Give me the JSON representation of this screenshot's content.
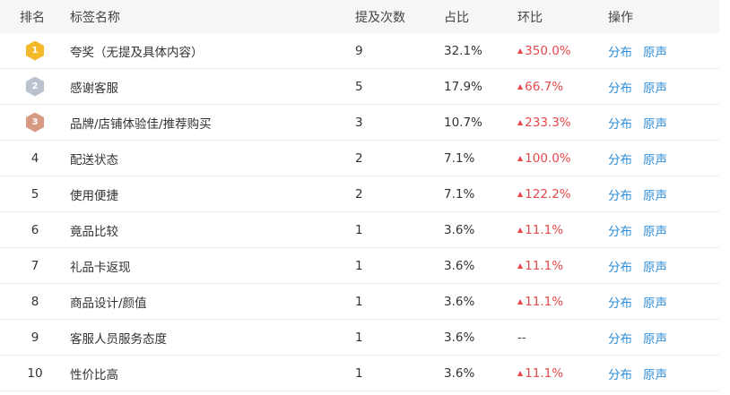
{
  "header": {
    "rank": "排名",
    "name": "标签名称",
    "count": "提及次数",
    "ratio": "占比",
    "change": "环比",
    "ops": "操作"
  },
  "colors": {
    "gold": "#f4b92b",
    "silver": "#b9c3cf",
    "bronze": "#d99a84",
    "up": "#e5484d",
    "link": "#2f8fd8"
  },
  "rows": [
    {
      "rank": "1",
      "name": "夸奖（无提及具体内容）",
      "count": "9",
      "ratio": "32.1%",
      "change": "350.0%",
      "dir": "up",
      "op1": "分布",
      "op2": "原声"
    },
    {
      "rank": "2",
      "name": "感谢客服",
      "count": "5",
      "ratio": "17.9%",
      "change": "66.7%",
      "dir": "up",
      "op1": "分布",
      "op2": "原声"
    },
    {
      "rank": "3",
      "name": "品牌/店铺体验佳/推荐购买",
      "count": "3",
      "ratio": "10.7%",
      "change": "233.3%",
      "dir": "up",
      "op1": "分布",
      "op2": "原声"
    },
    {
      "rank": "4",
      "name": "配送状态",
      "count": "2",
      "ratio": "7.1%",
      "change": "100.0%",
      "dir": "up",
      "op1": "分布",
      "op2": "原声"
    },
    {
      "rank": "5",
      "name": "使用便捷",
      "count": "2",
      "ratio": "7.1%",
      "change": "122.2%",
      "dir": "up",
      "op1": "分布",
      "op2": "原声"
    },
    {
      "rank": "6",
      "name": "竟品比较",
      "count": "1",
      "ratio": "3.6%",
      "change": "11.1%",
      "dir": "up",
      "op1": "分布",
      "op2": "原声"
    },
    {
      "rank": "7",
      "name": "礼品卡返现",
      "count": "1",
      "ratio": "3.6%",
      "change": "11.1%",
      "dir": "up",
      "op1": "分布",
      "op2": "原声"
    },
    {
      "rank": "8",
      "name": "商品设计/颜值",
      "count": "1",
      "ratio": "3.6%",
      "change": "11.1%",
      "dir": "up",
      "op1": "分布",
      "op2": "原声"
    },
    {
      "rank": "9",
      "name": "客服人员服务态度",
      "count": "1",
      "ratio": "3.6%",
      "change": "--",
      "dir": "flat",
      "op1": "分布",
      "op2": "原声"
    },
    {
      "rank": "10",
      "name": "性价比高",
      "count": "1",
      "ratio": "3.6%",
      "change": "11.1%",
      "dir": "up",
      "op1": "分布",
      "op2": "原声"
    }
  ]
}
